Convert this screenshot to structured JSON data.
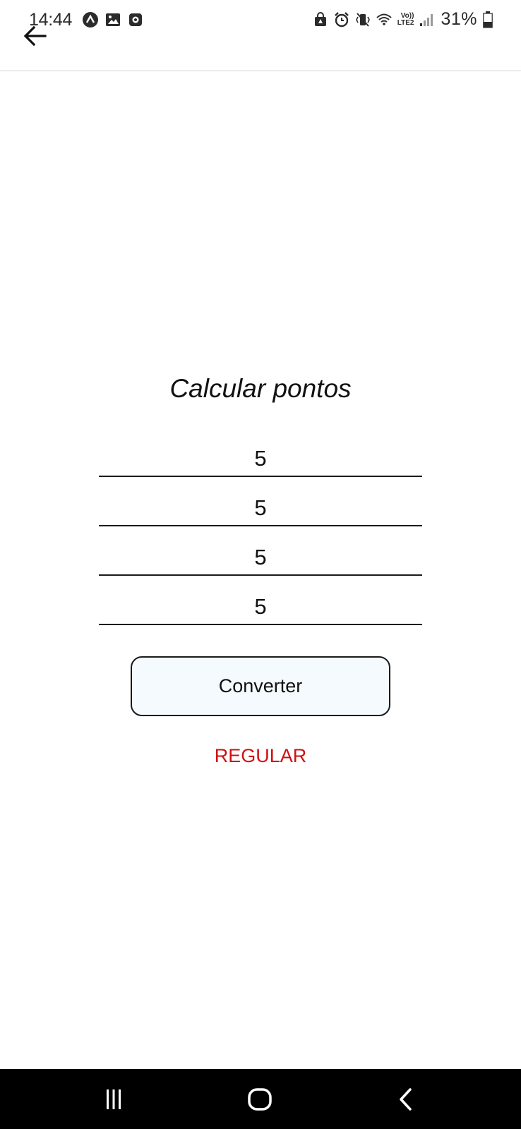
{
  "status_bar": {
    "time": "14:44",
    "battery_percent": "31%",
    "lte_top": "Vo))",
    "lte_bottom": "LTE2",
    "left_icons": [
      "navigation-app-icon",
      "gallery-icon",
      "media-icon"
    ],
    "right_icons": [
      "secure-folder-icon",
      "alarm-icon",
      "vibrate-icon",
      "wifi-icon",
      "signal-icon",
      "battery-icon"
    ]
  },
  "app_bar": {
    "back_icon": "arrow-left-icon"
  },
  "main": {
    "title": "Calcular pontos",
    "inputs": [
      {
        "value": "5"
      },
      {
        "value": "5"
      },
      {
        "value": "5"
      },
      {
        "value": "5"
      }
    ],
    "convert_button_label": "Converter",
    "result": "REGULAR",
    "result_color": "#d01010"
  },
  "nav_bar": {
    "buttons": [
      "recent-apps-icon",
      "home-icon",
      "back-icon"
    ]
  }
}
